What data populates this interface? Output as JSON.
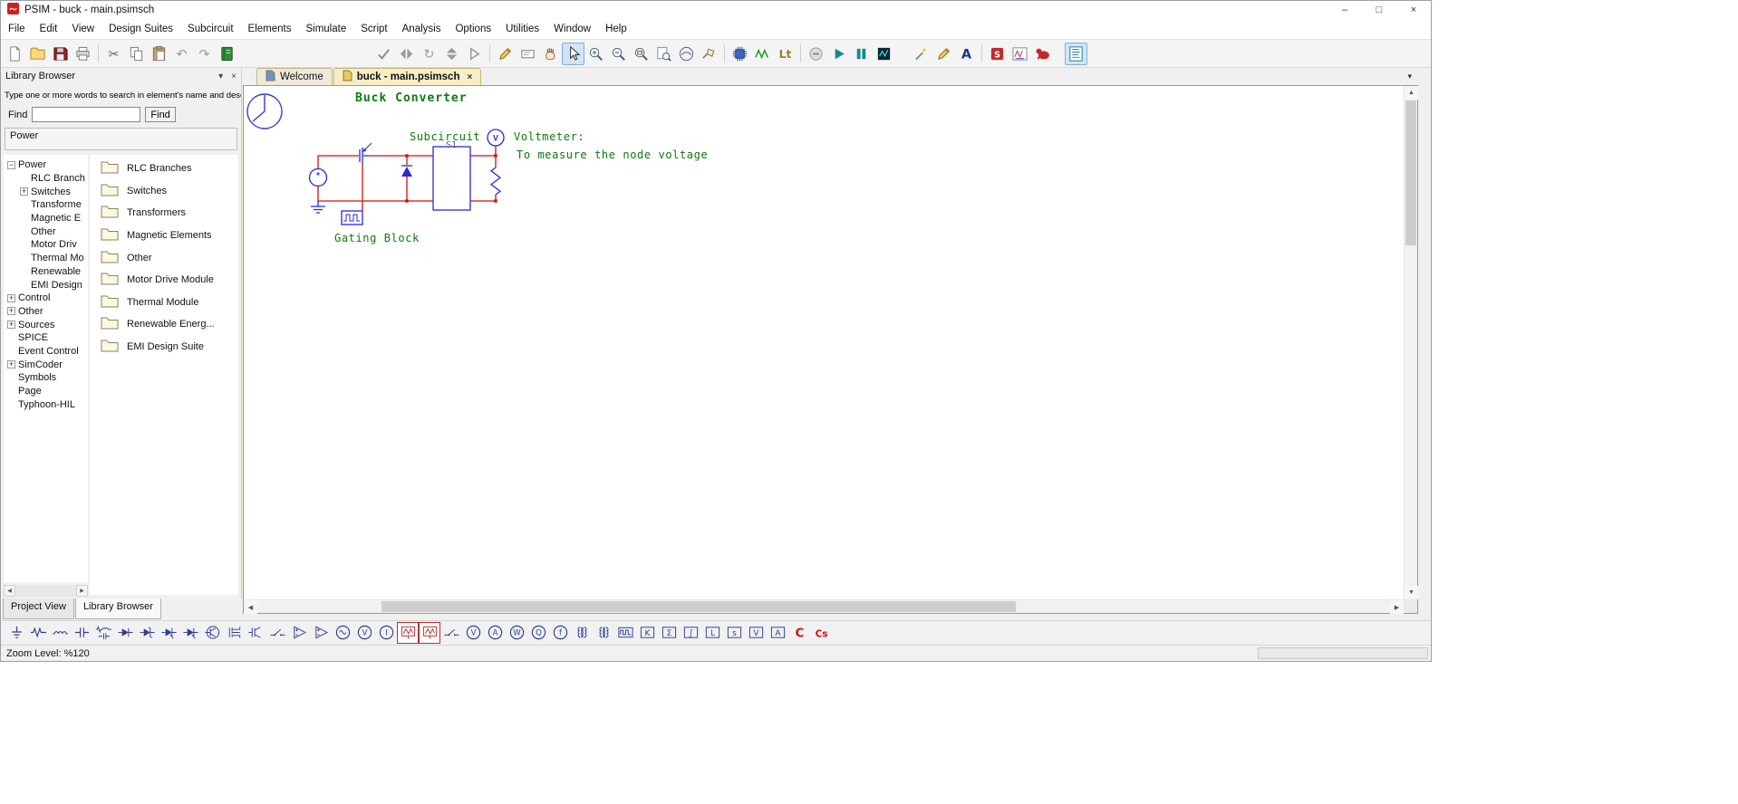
{
  "window": {
    "title": "PSIM - buck - main.psimsch"
  },
  "glyphs": {
    "close": "×",
    "minimize": "–",
    "maximize": "□",
    "chevron_down": "▾",
    "left": "◀",
    "right": "▶",
    "up": "▲",
    "down": "▼"
  },
  "colors": {
    "wire": "#cc1111",
    "component": "#2a2ad0",
    "annotation": "#0a7a0a",
    "canvas_border": "#cf9030",
    "active_tab_bg": "#f8eec6",
    "selection": "#cfe4f7"
  },
  "menubar": [
    "File",
    "Edit",
    "View",
    "Design Suites",
    "Subcircuit",
    "Elements",
    "Simulate",
    "Script",
    "Analysis",
    "Options",
    "Utilities",
    "Window",
    "Help"
  ],
  "toolbar": [
    {
      "name": "new-file-icon",
      "kind": "page"
    },
    {
      "name": "open-file-icon",
      "kind": "folder"
    },
    {
      "name": "save-file-icon",
      "kind": "floppy"
    },
    {
      "name": "print-icon",
      "kind": "printer"
    },
    {
      "sep": true
    },
    {
      "name": "cut-icon",
      "kind": "scissors"
    },
    {
      "name": "copy-icon",
      "kind": "copy"
    },
    {
      "name": "paste-icon",
      "kind": "paste"
    },
    {
      "name": "undo-icon",
      "kind": "undo"
    },
    {
      "name": "redo-icon",
      "kind": "redo"
    },
    {
      "name": "library-icon",
      "kind": "book"
    },
    {
      "gap": 148
    },
    {
      "name": "wire-check-icon",
      "kind": "check"
    },
    {
      "name": "mirror-icon",
      "kind": "mirror"
    },
    {
      "name": "rotate-icon",
      "kind": "rotate"
    },
    {
      "name": "flip-vertical-icon",
      "kind": "flipv"
    },
    {
      "name": "free-run-icon",
      "kind": "tri"
    },
    {
      "sep": true
    },
    {
      "name": "draw-wire-icon",
      "kind": "pencil"
    },
    {
      "name": "label-icon",
      "kind": "tag"
    },
    {
      "name": "pan-icon",
      "kind": "hand"
    },
    {
      "name": "select-icon",
      "kind": "cursor",
      "active": true
    },
    {
      "name": "zoom-in-icon",
      "kind": "zoomin"
    },
    {
      "name": "zoom-out-icon",
      "kind": "zoomout"
    },
    {
      "name": "zoom-window-icon",
      "kind": "zoomrect"
    },
    {
      "name": "zoom-fit-icon",
      "kind": "zoomfit"
    },
    {
      "name": "current-scope-icon",
      "kind": "scope"
    },
    {
      "name": "voltage-probe-tool-icon",
      "kind": "probehand"
    },
    {
      "sep": true
    },
    {
      "name": "simulation-control-icon",
      "kind": "chip"
    },
    {
      "name": "run-simulation-icon",
      "kind": "wavegreen"
    },
    {
      "name": "ltspice-icon",
      "kind": "lt"
    },
    {
      "sep": true
    },
    {
      "name": "stop-simulation-icon",
      "kind": "disable"
    },
    {
      "name": "run-icon",
      "kind": "play"
    },
    {
      "name": "pause-icon",
      "kind": "pause"
    },
    {
      "name": "runtime-graph-icon",
      "kind": "runtime"
    },
    {
      "gap": 16
    },
    {
      "name": "wizard-icon",
      "kind": "wand"
    },
    {
      "name": "edit-schematic-icon",
      "kind": "pencil"
    },
    {
      "name": "text-tool-icon",
      "kind": "atext"
    },
    {
      "sep": true
    },
    {
      "name": "smartctrl-icon",
      "kind": "smartctrl"
    },
    {
      "name": "simview-icon",
      "kind": "simview"
    },
    {
      "name": "motor-drive-icon",
      "kind": "motor"
    },
    {
      "gap": 12
    },
    {
      "name": "script-view-icon",
      "kind": "script",
      "active": true
    }
  ],
  "library": {
    "header": "Library Browser",
    "hint": "Type one or more words to search in element's name and  desc",
    "find_label": "Find",
    "find_button": "Find",
    "find_value": "",
    "section": "Power",
    "tree": [
      {
        "label": "Power",
        "level": 0,
        "expander": "minus"
      },
      {
        "label": "RLC Branch",
        "level": 1
      },
      {
        "label": "Switches",
        "level": 1,
        "expander": "plus"
      },
      {
        "label": "Transforme",
        "level": 1
      },
      {
        "label": "Magnetic E",
        "level": 1
      },
      {
        "label": "Other",
        "level": 1
      },
      {
        "label": "Motor Driv",
        "level": 1
      },
      {
        "label": "Thermal Mo",
        "level": 1
      },
      {
        "label": "Renewable",
        "level": 1
      },
      {
        "label": "EMI Design",
        "level": 1
      },
      {
        "label": "Control",
        "level": 0,
        "expander": "plus"
      },
      {
        "label": "Other",
        "level": 0,
        "expander": "plus"
      },
      {
        "label": "Sources",
        "level": 0,
        "expander": "plus"
      },
      {
        "label": "SPICE",
        "level": 0
      },
      {
        "label": "Event Control",
        "level": 0
      },
      {
        "label": "SimCoder",
        "level": 0,
        "expander": "plus"
      },
      {
        "label": "Symbols",
        "level": 0
      },
      {
        "label": "Page",
        "level": 0
      },
      {
        "label": "Typhoon-HIL",
        "level": 0
      }
    ],
    "folders": [
      "RLC Branches",
      "Switches",
      "Transformers",
      "Magnetic Elements",
      "Other",
      "Motor Drive Module",
      "Thermal Module",
      "Renewable Energ...",
      "EMI Design Suite"
    ],
    "bottom_tabs": [
      {
        "label": "Project View",
        "active": false
      },
      {
        "label": "Library Browser",
        "active": true
      }
    ]
  },
  "document": {
    "tabs": [
      {
        "label": "Welcome",
        "active": false,
        "closable": false,
        "icon": "welcome-tab-icon",
        "icon_color": "#6a93cc"
      },
      {
        "label": "buck - main.psimsch",
        "active": true,
        "closable": true,
        "icon": "schematic-tab-icon",
        "icon_color": "#ecc75e"
      }
    ],
    "schematic": {
      "title": "Buck Converter",
      "subcircuit_label": "Subcircuit",
      "instance_label": "S1",
      "voltmeter_heading": "Voltmeter:",
      "voltmeter_note": "To measure the node voltage",
      "gating_label": "Gating Block",
      "voltmeter_symbol": "V"
    }
  },
  "element_toolbar": [
    {
      "name": "ground-icon",
      "kind": "ground"
    },
    {
      "name": "resistor-icon",
      "kind": "res"
    },
    {
      "name": "inductor-icon",
      "kind": "coil"
    },
    {
      "name": "capacitor-icon",
      "kind": "cap"
    },
    {
      "name": "rlc-branch-icon",
      "kind": "rlc"
    },
    {
      "name": "diode-icon",
      "kind": "diode"
    },
    {
      "name": "zener-diode-icon",
      "kind": "zener"
    },
    {
      "name": "thyristor-icon",
      "kind": "scr"
    },
    {
      "name": "gto-icon",
      "kind": "scr"
    },
    {
      "name": "npn-transistor-icon",
      "kind": "bjt"
    },
    {
      "name": "mosfet-icon",
      "kind": "mosfet"
    },
    {
      "name": "igbt-icon",
      "kind": "igbt"
    },
    {
      "name": "bidirectional-switch-icon",
      "kind": "sw"
    },
    {
      "name": "opamp-icon",
      "kind": "opamp"
    },
    {
      "name": "comparator-icon",
      "kind": "opamp"
    },
    {
      "name": "ac-voltage-source-icon",
      "kind": "circwave"
    },
    {
      "name": "dc-voltage-source-icon",
      "kind": "circ",
      "letter": "V"
    },
    {
      "name": "current-source-icon",
      "kind": "circ",
      "letter": "I"
    },
    {
      "name": "voltage-probe-icon",
      "kind": "probe",
      "framed": true
    },
    {
      "name": "current-probe-icon",
      "kind": "probe",
      "framed": true
    },
    {
      "name": "on-off-switch-icon",
      "kind": "sw"
    },
    {
      "name": "voltmeter-icon",
      "kind": "circ",
      "letter": "V"
    },
    {
      "name": "ammeter-icon",
      "kind": "circ",
      "letter": "A"
    },
    {
      "name": "wattmeter-icon",
      "kind": "circ",
      "letter": "W"
    },
    {
      "name": "var-meter-icon",
      "kind": "circ",
      "letter": "Q"
    },
    {
      "name": "frequency-meter-icon",
      "kind": "circ",
      "letter": "f"
    },
    {
      "name": "transformer-icon",
      "kind": "xfmr"
    },
    {
      "name": "three-phase-transformer-icon",
      "kind": "xfmr"
    },
    {
      "name": "gating-block-icon",
      "kind": "pulsebox"
    },
    {
      "name": "gain-block-icon",
      "kind": "box",
      "letter": "K"
    },
    {
      "name": "summer-block-icon",
      "kind": "box",
      "letter": "Σ"
    },
    {
      "name": "integrator-block-icon",
      "kind": "box",
      "letter": "∫"
    },
    {
      "name": "limiter-block-icon",
      "kind": "box",
      "letter": "L"
    },
    {
      "name": "transfer-function-block-icon",
      "kind": "box",
      "letter": "s"
    },
    {
      "name": "voltage-sensor-icon",
      "kind": "box",
      "letter": "V"
    },
    {
      "name": "current-sensor-icon",
      "kind": "box",
      "letter": "A"
    },
    {
      "name": "c-block-icon",
      "kind": "redletter",
      "letter": "C"
    },
    {
      "name": "simplified-c-block-icon",
      "kind": "redletter",
      "letter": "Cs"
    }
  ],
  "statusbar": {
    "zoom": "Zoom Level: %120"
  }
}
